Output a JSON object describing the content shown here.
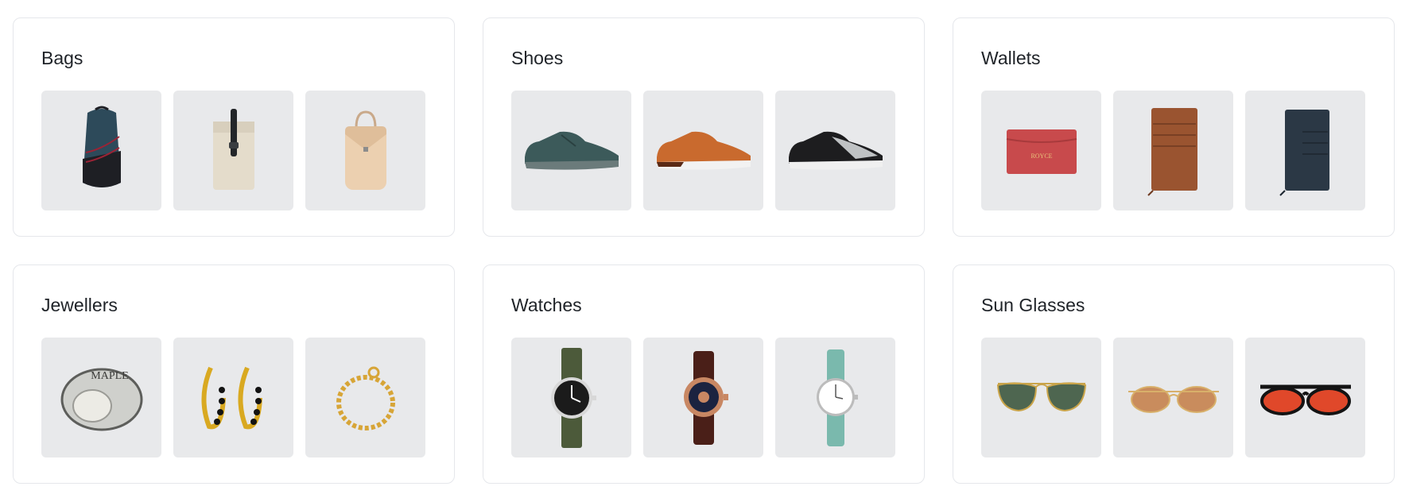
{
  "categories": [
    {
      "title": "Bags",
      "items": [
        {
          "icon": "backpack-icon",
          "colors": [
            "#2d4a5a",
            "#1e1f24",
            "#9b2335"
          ]
        },
        {
          "icon": "rolltop-backpack-icon",
          "colors": [
            "#e4dccb",
            "#232629"
          ]
        },
        {
          "icon": "mini-backpack-icon",
          "colors": [
            "#ecd0b0",
            "#c9a98a"
          ]
        }
      ]
    },
    {
      "title": "Shoes",
      "items": [
        {
          "icon": "sneaker-icon",
          "colors": [
            "#3c5a5a",
            "#6b7b7b"
          ]
        },
        {
          "icon": "sneaker-icon",
          "colors": [
            "#c96a2e",
            "#f2f2f2"
          ]
        },
        {
          "icon": "sneaker-icon",
          "colors": [
            "#1d1d1f",
            "#bfc2c4"
          ]
        }
      ]
    },
    {
      "title": "Wallets",
      "items": [
        {
          "icon": "cardholder-icon",
          "colors": [
            "#c84a4c",
            "#e8c27a"
          ],
          "text": "ROYCE"
        },
        {
          "icon": "zip-cardholder-icon",
          "colors": [
            "#9a5430",
            "#6e3a20"
          ]
        },
        {
          "icon": "zip-cardholder-icon",
          "colors": [
            "#2b3845",
            "#1c252e"
          ]
        }
      ]
    },
    {
      "title": "Jewellers",
      "items": [
        {
          "icon": "signet-ring-icon",
          "colors": [
            "#cfd0cc",
            "#5d5e5b"
          ],
          "text": "MAPLE"
        },
        {
          "icon": "hoop-earrings-icon",
          "colors": [
            "#d9a921",
            "#121212"
          ]
        },
        {
          "icon": "chain-bracelet-icon",
          "colors": [
            "#d7a537"
          ]
        }
      ]
    },
    {
      "title": "Watches",
      "items": [
        {
          "icon": "field-watch-icon",
          "colors": [
            "#4c5a3a",
            "#1b1b1b",
            "#d8d8d8"
          ]
        },
        {
          "icon": "dress-watch-icon",
          "colors": [
            "#4a1f18",
            "#c88763",
            "#1b2340"
          ]
        },
        {
          "icon": "minimal-watch-icon",
          "colors": [
            "#7ab9ad",
            "#bcbcbc",
            "#ffffff"
          ]
        }
      ]
    },
    {
      "title": "Sun Glasses",
      "items": [
        {
          "icon": "aviator-sunglasses-icon",
          "colors": [
            "#4e6650",
            "#c9a44a"
          ]
        },
        {
          "icon": "round-sunglasses-icon",
          "colors": [
            "#c98c5d",
            "#d8b06a"
          ]
        },
        {
          "icon": "sport-sunglasses-icon",
          "colors": [
            "#e0482a",
            "#141414"
          ]
        }
      ]
    }
  ]
}
